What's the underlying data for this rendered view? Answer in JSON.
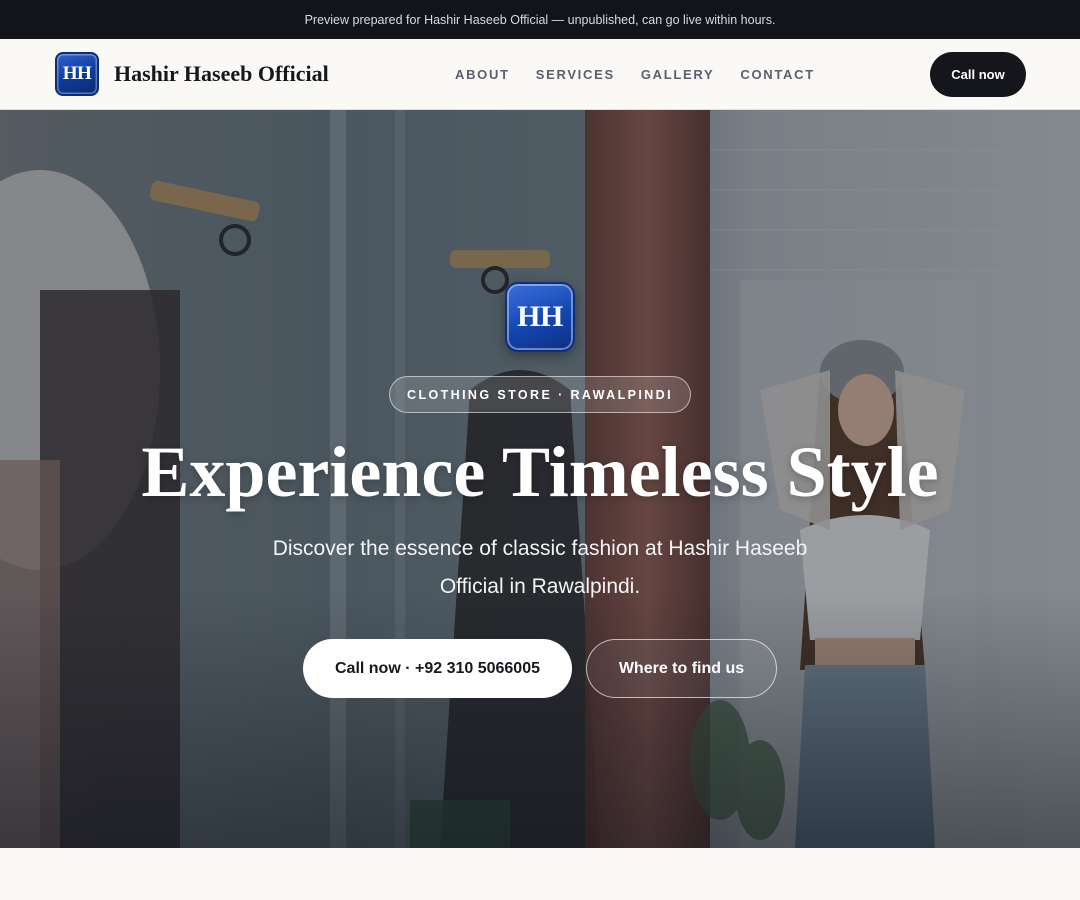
{
  "banner": {
    "text": "Preview prepared for Hashir Haseeb Official — unpublished, can go live within hours."
  },
  "brand": {
    "initials": "HH",
    "name": "Hashir Haseeb Official"
  },
  "nav": {
    "links": [
      "ABOUT",
      "SERVICES",
      "GALLERY",
      "CONTACT"
    ],
    "call_label": "Call now"
  },
  "hero": {
    "logo_initials": "HH",
    "tag": "CLOTHING STORE · RAWALPINDI",
    "title": "Experience Timeless Style",
    "subtitle": "Discover the essence of classic fashion at Hashir Haseeb Official in Rawalpindi.",
    "primary_button": "Call now · +92 310 5066005",
    "secondary_button": "Where to find us"
  },
  "colors": {
    "banner_bg": "#12141a",
    "nav_bg": "#faf9f6",
    "brand_blue": "#1446b0",
    "dark_button": "#14161c"
  }
}
